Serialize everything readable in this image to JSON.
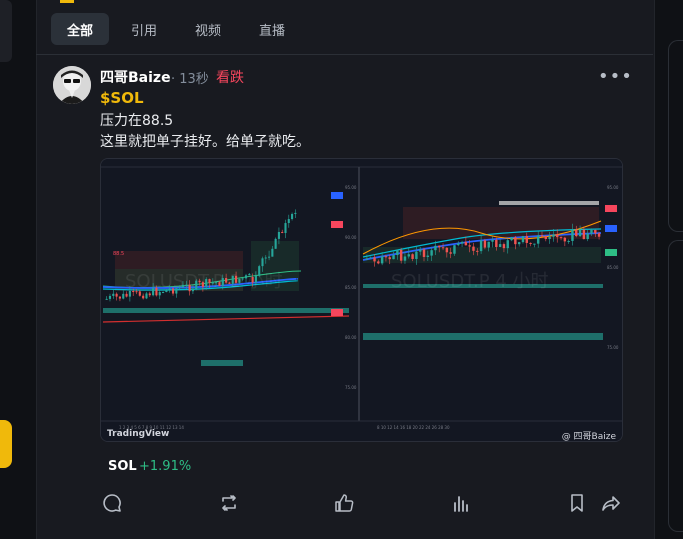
{
  "tabs": [
    {
      "label": "全部",
      "active": true
    },
    {
      "label": "引用",
      "active": false
    },
    {
      "label": "视频",
      "active": false
    },
    {
      "label": "直播",
      "active": false
    }
  ],
  "post": {
    "author": "四哥Baize",
    "time": "· 13秒",
    "sentiment": "看跌",
    "ticker": "$SOL",
    "lines": [
      "压力在88.5",
      "这里就把单子挂好。给单子就吃。"
    ],
    "chart": {
      "brand": "TradingView",
      "watermark_user": "@ 四哥Baize",
      "left_panel_watermark": "SOLUSDT.P 1 小时",
      "right_panel_watermark": "SOLUSDT.P 4 小时"
    },
    "coin": {
      "name": "SOL",
      "change": "+1.91%"
    }
  },
  "actions": [
    "comment-icon",
    "repost-icon",
    "like-icon",
    "stats-icon",
    "bookmark-icon",
    "share-icon"
  ],
  "colors": {
    "accent": "#f0b90b",
    "bearish": "#f6465d",
    "bullish": "#2ebd85",
    "background": "#181a20"
  }
}
